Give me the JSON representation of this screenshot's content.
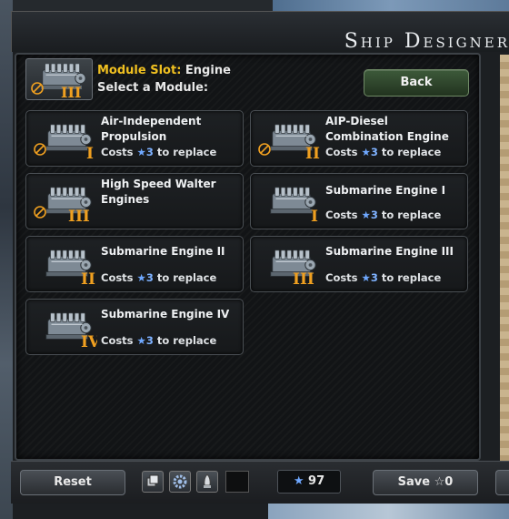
{
  "window": {
    "title": "Ship Designer"
  },
  "header": {
    "slot_prefix": "Module Slot:",
    "slot_value": "Engine",
    "select_label": "Select a Module:",
    "current_tier": "III",
    "back_label": "Back"
  },
  "modules": [
    {
      "name": "Air-Independent Propulsion",
      "tier": "I",
      "cost_prefix": "Costs",
      "cost": "3",
      "cost_suffix": "to replace",
      "has_badge": true
    },
    {
      "name": "AIP-Diesel Combination Engine",
      "tier": "II",
      "cost_prefix": "Costs",
      "cost": "3",
      "cost_suffix": "to replace",
      "has_badge": true
    },
    {
      "name": "High Speed Walter Engines",
      "tier": "III",
      "cost_prefix": "",
      "cost": "",
      "cost_suffix": "",
      "has_badge": true
    },
    {
      "name": "Submarine Engine I",
      "tier": "I",
      "cost_prefix": "Costs",
      "cost": "3",
      "cost_suffix": "to replace",
      "has_badge": false
    },
    {
      "name": "Submarine Engine II",
      "tier": "II",
      "cost_prefix": "Costs",
      "cost": "3",
      "cost_suffix": "to replace",
      "has_badge": false
    },
    {
      "name": "Submarine Engine III",
      "tier": "III",
      "cost_prefix": "Costs",
      "cost": "3",
      "cost_suffix": "to replace",
      "has_badge": false
    },
    {
      "name": "Submarine Engine IV",
      "tier": "IV",
      "cost_prefix": "Costs",
      "cost": "3",
      "cost_suffix": "to replace",
      "has_badge": false
    }
  ],
  "footer": {
    "reset_label": "Reset",
    "points": "97",
    "save_label": "Save",
    "save_cost": "0"
  },
  "colors": {
    "accent_gold": "#f0c020",
    "tier_orange": "#f0a020",
    "star_blue": "#6fa8ff",
    "back_green": "#3d5a3a"
  },
  "icons": [
    "engine-icon",
    "no-fuel-badge-icon",
    "star-icon"
  ]
}
